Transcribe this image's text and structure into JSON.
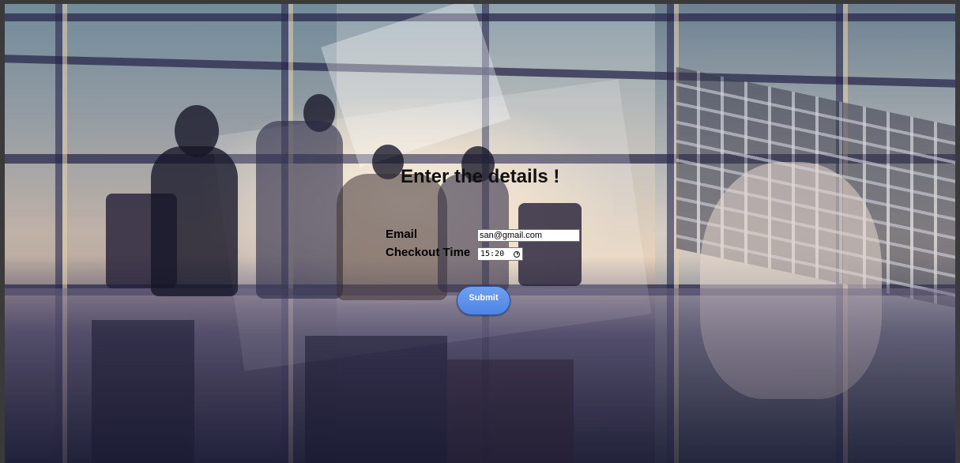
{
  "form": {
    "title": "Enter the details !",
    "email_label": "Email",
    "email_value": "san@gmail.com",
    "checkout_label": "Checkout Time",
    "checkout_value": "15:20",
    "submit_label": "Submit"
  },
  "background": {
    "image_subject": "office-meeting-collage-background",
    "colors": {
      "accent_button": "#5b8fea",
      "title_text": "#111111"
    }
  },
  "icons": {
    "time_picker": "clock-icon"
  }
}
